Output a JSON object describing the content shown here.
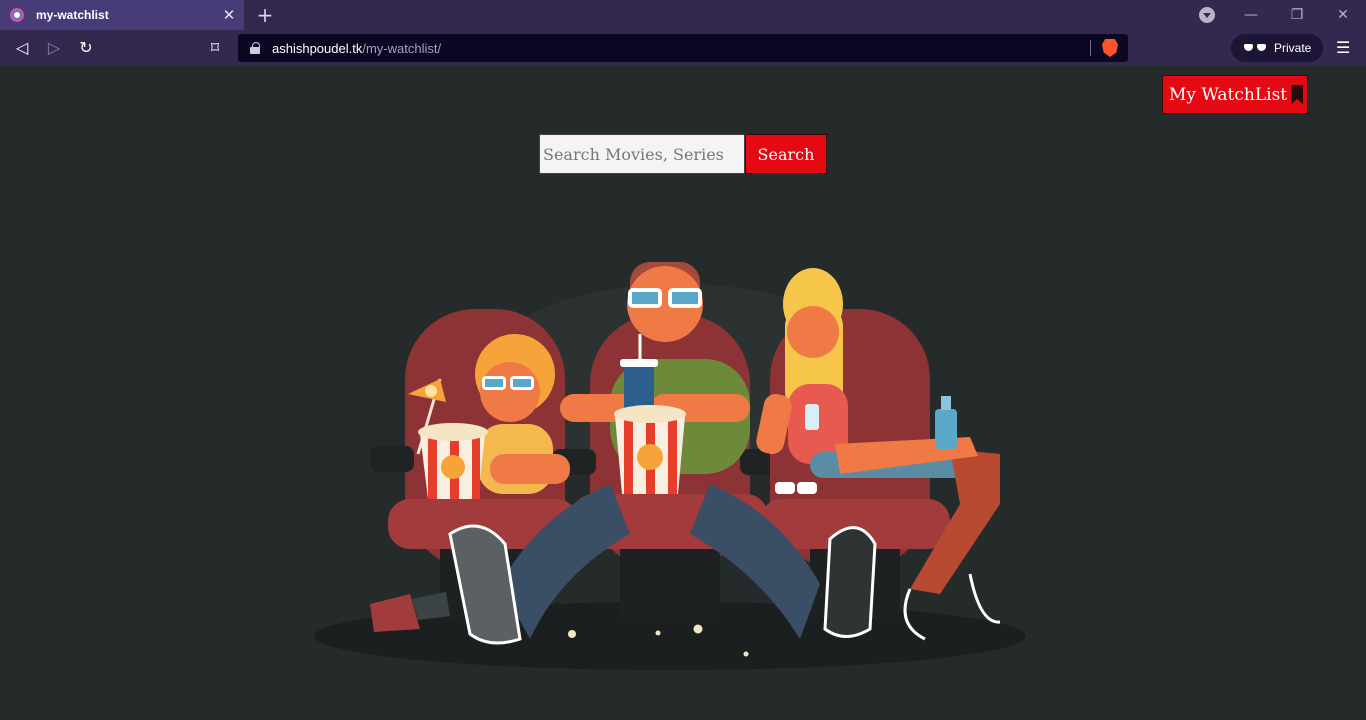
{
  "browser": {
    "tab_title": "my-watchlist",
    "url_domain": "ashishpoudel.tk",
    "url_path": "/my-watchlist/",
    "private_label": "Private"
  },
  "header": {
    "watchlist_label": "My WatchList"
  },
  "search": {
    "placeholder": "Search Movies, Series",
    "value": "",
    "button_label": "Search"
  },
  "colors": {
    "accent": "#e50914",
    "background": "#252a2a",
    "browser_frame": "#35284f"
  },
  "icons": {
    "hero": "movie-family-illustration"
  }
}
